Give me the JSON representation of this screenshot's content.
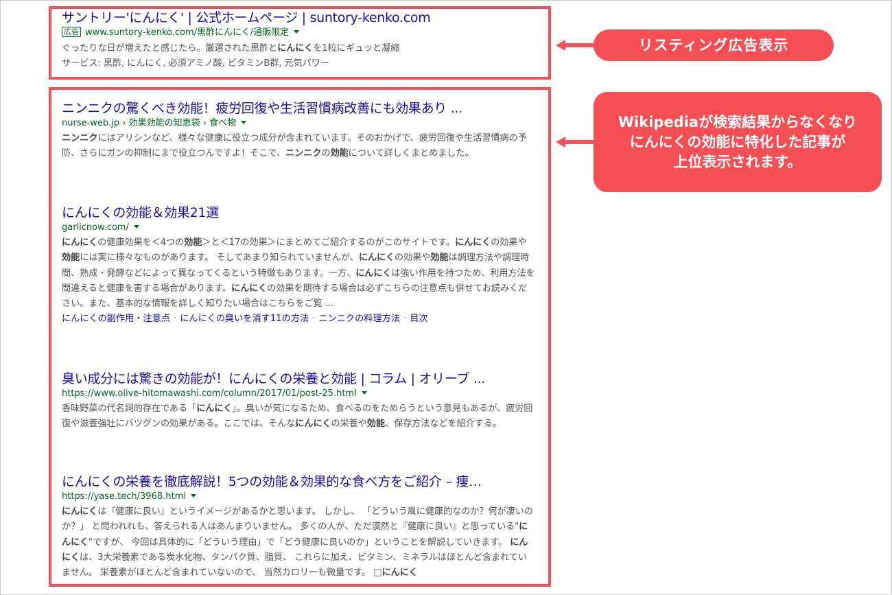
{
  "ad": {
    "title": "サントリー'にんにく' | 公式ホームページ | suntory-kenko.com",
    "badge": "広告",
    "url": "www.suntory-kenko.com/黒酢にんにく/通販限定",
    "line1_a": "ぐったりな日が増えたと感じたら。厳選された黒酢と",
    "line1_b": "にんにく",
    "line1_c": "を1粒にギュッと凝縮",
    "line2": "サービス: 黒酢, にんにく, 必須アミノ酸, ビタミンB群, 元気パワー"
  },
  "results": [
    {
      "title": "ニンニクの驚くべき効能！疲労回復や生活習慣病改善にも効果あり ...",
      "url": "nurse-web.jp › 効果効能の知恵袋 › 食べ物",
      "s1": "ニンニク",
      "s2": "にはアリシンなど、様々な健康に役立つ成分が含まれています。そのおかげで、疲労回復や生活習慣病の予防、さらにガンの抑制にまで役立つんですよ！そこで、",
      "s3": "ニンニク",
      "s4": "の",
      "s5": "効能",
      "s6": "について詳しくまとめました。"
    },
    {
      "title": "にんにくの効能＆効果21選",
      "url": "garlicnow.com/",
      "s1": "にんにく",
      "s2": "の健康効果を＜4つの",
      "s3": "効能",
      "s4": "＞と＜17の効果＞にまとめてご紹介するのがこのサイトです。",
      "s5": "にんにく",
      "s6": "の効果や",
      "s7": "効能",
      "s8": "には実に様々なものがあります。 そしてあまり知られていませんが、",
      "s9": "にんにく",
      "s10": "の効果や",
      "s11": "効能",
      "s12": "は調理方法や調理時間、熟成・発酵などによって異なってくるという特徴もあります。一方、",
      "s13": "にんにく",
      "s14": "は強い作用を持つため、利用方法を間違えると健康を害する場合があります。",
      "s15": "にんにく",
      "s16": "の効果を期待する場合は必ずこちらの注意点も併せてお読みください。また、基本的な情報を詳しく知りたい場合はこちらをご覧 ...",
      "sitelinks": [
        "にんにくの副作用・注意点",
        "にんにくの臭いを消す11の方法",
        "ニンニクの料理方法",
        "目次"
      ]
    },
    {
      "title": "臭い成分には驚きの効能が！にんにくの栄養と効能 | コラム | オリーブ ...",
      "url": "https://www.olive-hitomawashi.com/column/2017/01/post-25.html",
      "s1": "香味野菜の代名詞的存在である「",
      "s2": "にんにく",
      "s3": "」。臭いが気になるため、食べるのをためらうという意見もあるが、疲労回復や滋養強壮にバツグンの効果がある。ここでは、そんな",
      "s4": "にんにく",
      "s5": "の栄養や",
      "s6": "効能",
      "s7": "、保存方法などを紹介する。"
    },
    {
      "title": "にんにくの栄養を徹底解説！5つの効能＆効果的な食べ方をご紹介 – 痩…",
      "url": "https://yase.tech/3968.html",
      "s1": "にんにく",
      "s2": "は『健康に良い』というイメージがあるかと思います。 しかし、 「どういう風に健康的なのか？何が凄いのか？」 と問われれも、答えられる人はあんまりいません。 多くの人が、ただ漠然と『健康に良い』と思っている\"",
      "s3": "にんにく",
      "s4": "\"ですが、 今回は具体的に「どういう理由」で「どう健康に良いのか」ということを解説していきます。 ",
      "s5": "にんにく",
      "s6": "は、3大栄養素である炭水化物、タンパク質、脂質、 これらに加え、ビタミン、ミネラルはほとんど含まれていません。 栄養素がほとんど含まれていないので、 当然カロリーも微量です。 □",
      "s7": "にんにく"
    }
  ],
  "callouts": {
    "ad_label": "リスティング広告表示",
    "organic_line1": "Wikipediaが検索結果からなくなり",
    "organic_line2": "にんにくの効能に特化した記事が",
    "organic_line3": "上位表示されます。"
  },
  "colors": {
    "accent_red": "#f2525c",
    "link_blue": "#1a0dab",
    "url_green": "#006621"
  }
}
